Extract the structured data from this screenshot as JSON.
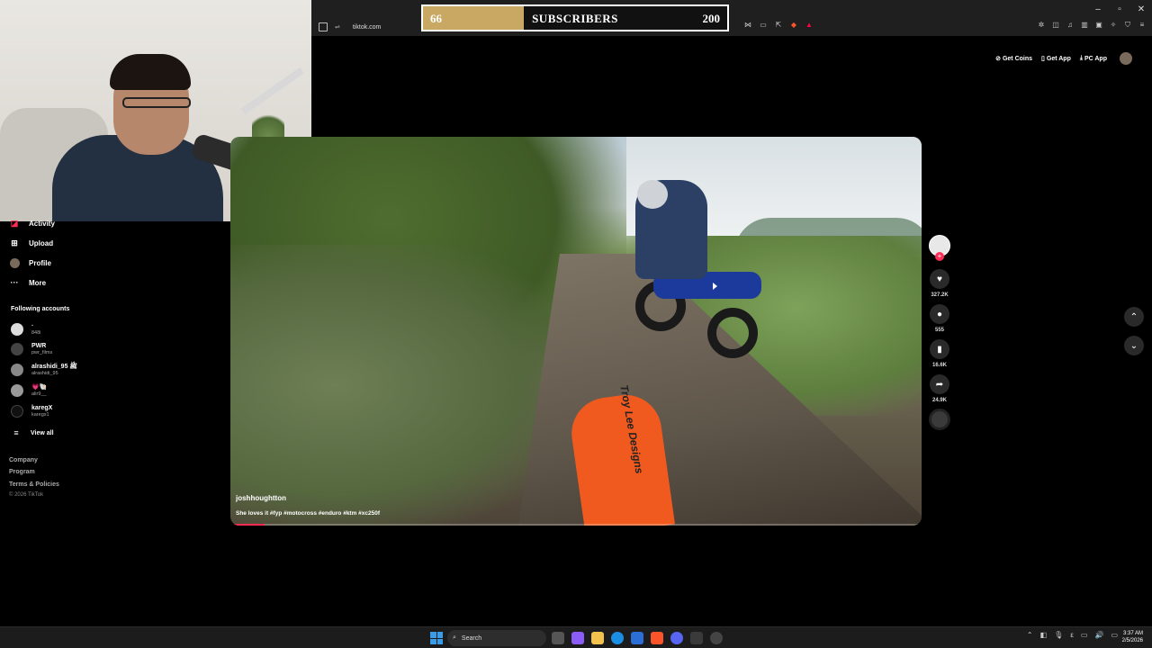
{
  "browser": {
    "url": "tiktok.com",
    "window_controls": [
      "–",
      "▫",
      "✕"
    ]
  },
  "subscriber_overlay": {
    "current": "66",
    "label": "SUBSCRIBERS",
    "goal": "200",
    "progress_fraction": 0.33,
    "fill_color": "#c9a863"
  },
  "sidebar": {
    "items": [
      {
        "label": "Activity",
        "icon": "activity-icon"
      },
      {
        "label": "Upload",
        "icon": "upload-icon"
      },
      {
        "label": "Profile",
        "icon": "profile-avatar"
      },
      {
        "label": "More",
        "icon": "more-icon"
      }
    ],
    "following_title": "Following accounts",
    "accounts": [
      {
        "name": "·",
        "handle": "848i"
      },
      {
        "name": "PWR",
        "handle": "pwr_films"
      },
      {
        "name": "alrashidi_95 ﷺ",
        "handle": "alrashidi_95"
      },
      {
        "name": "💗🐚",
        "handle": "alir9__"
      },
      {
        "name": "karegX",
        "handle": "karegx1"
      }
    ],
    "view_all": "View all",
    "footer_links": [
      "Company",
      "Program",
      "Terms & Policies"
    ],
    "copyright": "© 2026 TikTok"
  },
  "top_actions": {
    "get_coins": "Get Coins",
    "get_app": "Get App",
    "pc_app": "PC App"
  },
  "video": {
    "author": "joshhoughtton",
    "caption": "She loves it #fyp #motocross #enduro #ktm #xc250f",
    "progress_fraction": 0.05,
    "more": "···",
    "fender_text": "Troy Lee Designs"
  },
  "actions": {
    "likes": "327.2K",
    "comments": "555",
    "saves": "16.6K",
    "shares": "24.9K"
  },
  "taskbar": {
    "search_placeholder": "Search",
    "time": "3:37 AM",
    "date": "2/5/2026"
  },
  "colors": {
    "accent": "#fe2c55",
    "background": "#000000"
  }
}
